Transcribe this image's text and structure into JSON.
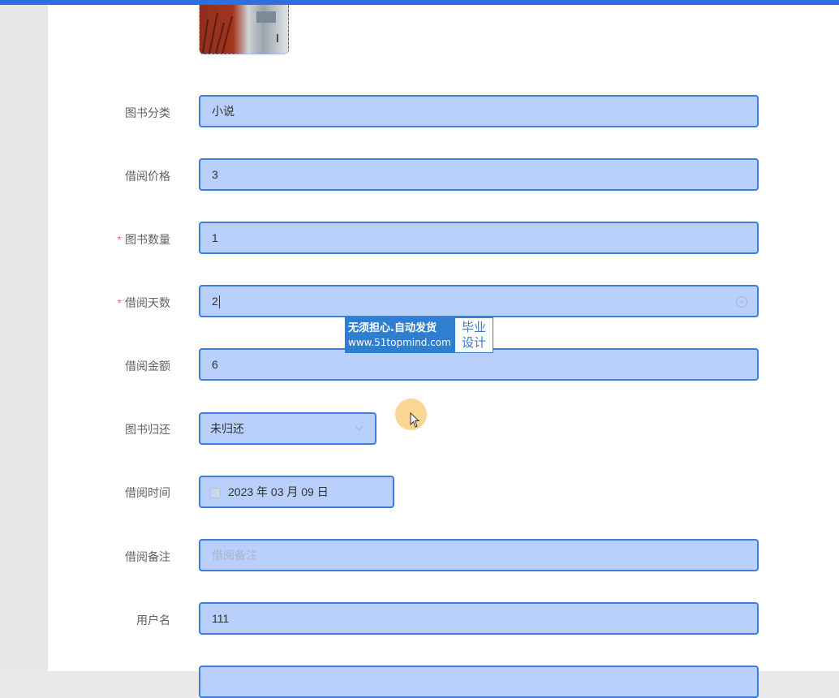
{
  "fields": {
    "category": {
      "label": "图书分类",
      "value": "小说"
    },
    "price": {
      "label": "借阅价格",
      "value": "3"
    },
    "quantity": {
      "label": "图书数量",
      "required_mark": "*",
      "value": "1"
    },
    "days": {
      "label": "借阅天数",
      "required_mark": "*",
      "value": "2"
    },
    "amount": {
      "label": "借阅金额",
      "value": "6"
    },
    "return_status": {
      "label": "图书归还",
      "selected": "未归还"
    },
    "borrow_time": {
      "label": "借阅时间",
      "value": "2023 年 03 月 09 日"
    },
    "remark": {
      "label": "借阅备注",
      "placeholder": "借阅备注",
      "value": ""
    },
    "username": {
      "label": "用户名",
      "value": "111"
    }
  },
  "watermark": {
    "line1": "无须担心.自动发货",
    "line2": "www.51topmind.com",
    "right": "毕业设计"
  },
  "colors": {
    "accent": "#3d7de0",
    "field_bg": "#b8d0fb",
    "required": "#f56c6c",
    "top_bar": "#2b6fe0"
  }
}
